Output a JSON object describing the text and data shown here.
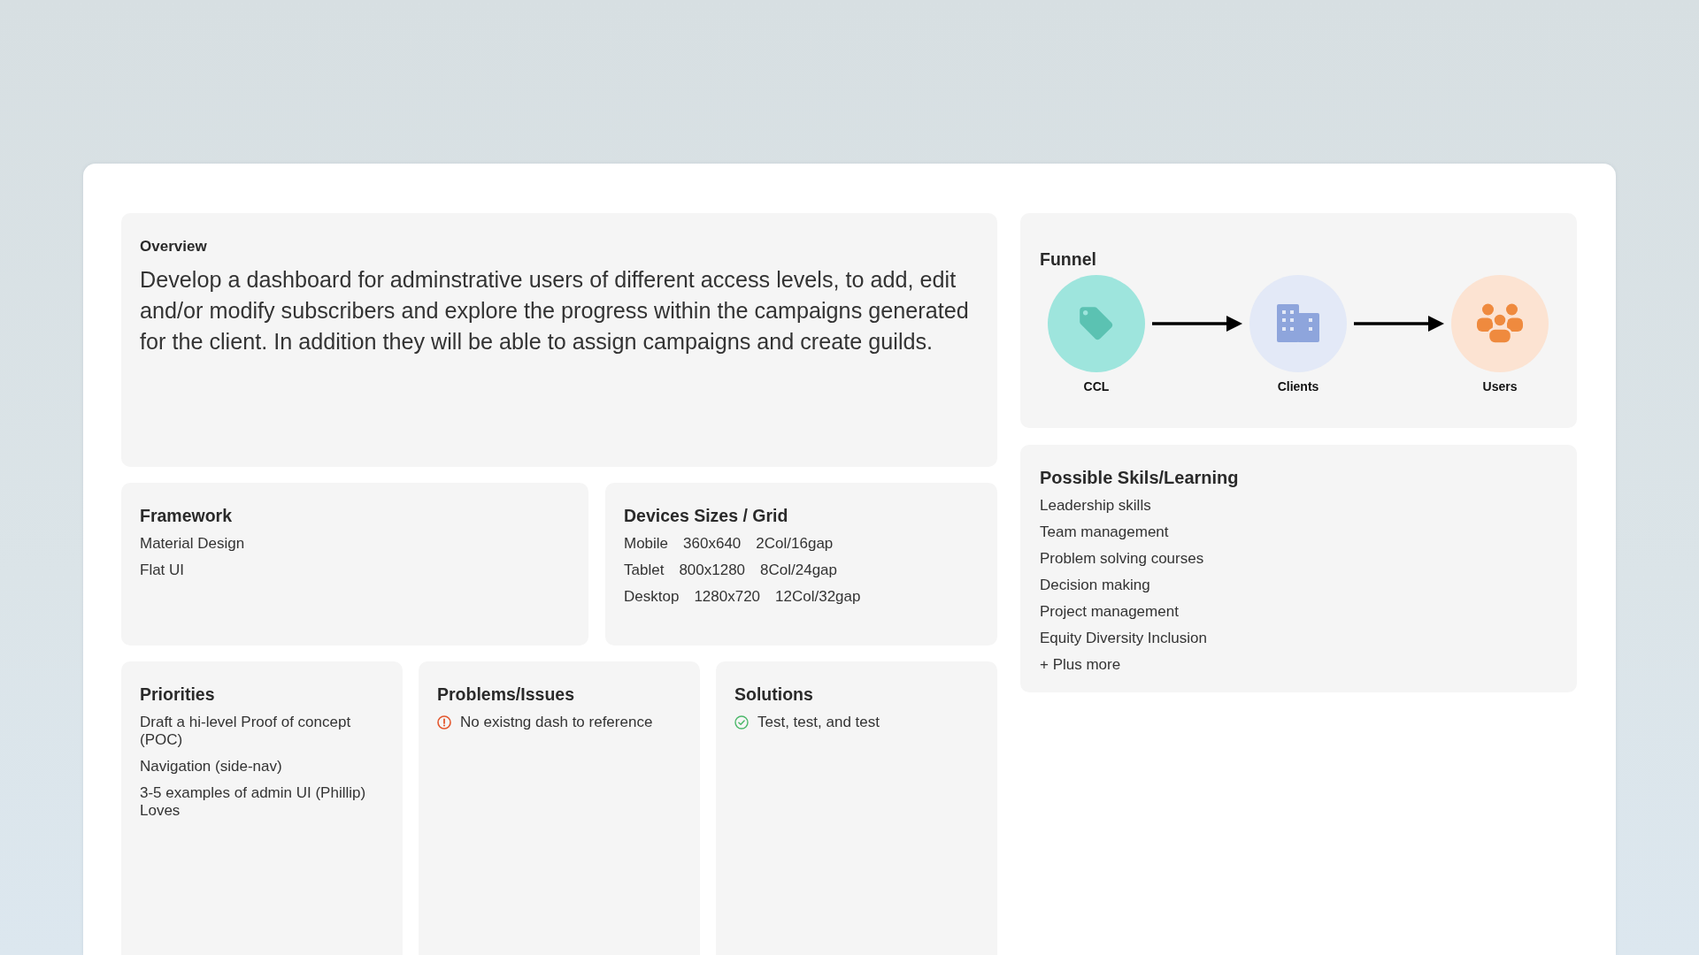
{
  "overview": {
    "title": "Overview",
    "text": "Develop a dashboard for adminstrative users of different access levels, to add, edit and/or modify subscribers and explore the progress within the campaigns generated for the client. In addition they will be able to assign campaigns and create guilds."
  },
  "funnel": {
    "title": "Funnel",
    "steps": [
      {
        "kind": "tag",
        "label": "CCL"
      },
      {
        "kind": "building",
        "label": "Clients"
      },
      {
        "kind": "people",
        "label": "Users"
      }
    ]
  },
  "framework": {
    "title": "Framework",
    "items": [
      "Material Design",
      "Flat UI"
    ]
  },
  "devices": {
    "title": "Devices Sizes / Grid",
    "rows": [
      {
        "device": "Mobile",
        "size": "360x640",
        "grid": "2Col/16gap"
      },
      {
        "device": "Tablet",
        "size": "800x1280",
        "grid": "8Col/24gap"
      },
      {
        "device": "Desktop",
        "size": "1280x720",
        "grid": "12Col/32gap"
      }
    ]
  },
  "skills": {
    "title": "Possible Skils/Learning",
    "items": [
      "Leadership skills",
      "Team management",
      "Problem solving courses",
      "Decision making",
      "Project management",
      "Equity Diversity Inclusion",
      "+ Plus more"
    ]
  },
  "priorities": {
    "title": "Priorities",
    "items": [
      "Draft a hi-level Proof of concept (POC)",
      "Navigation (side-nav)",
      "3-5 examples of admin UI (Phillip) Loves"
    ]
  },
  "problems": {
    "title": "Problems/Issues",
    "items": [
      {
        "kind": "warning",
        "text": "No existng dash to reference"
      }
    ]
  },
  "solutions": {
    "title": "Solutions",
    "items": [
      {
        "kind": "check",
        "text": "Test, test, and test"
      }
    ]
  }
}
